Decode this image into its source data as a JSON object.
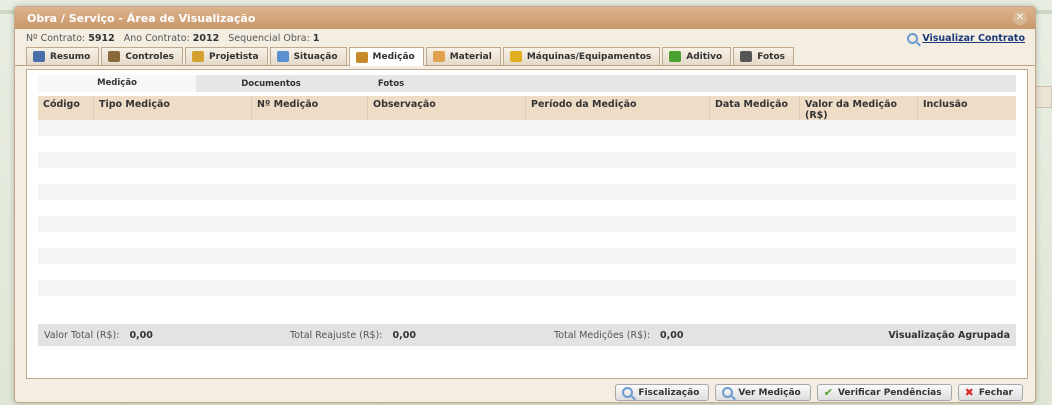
{
  "window": {
    "title": "Obra / Serviço - Área de Visualização",
    "close": "✕"
  },
  "info": {
    "contrato_label": "Nº Contrato:",
    "contrato_value": "5912",
    "ano_label": "Ano Contrato:",
    "ano_value": "2012",
    "seq_label": "Sequencial Obra:",
    "seq_value": "1",
    "view_contract": "Visualizar Contrato"
  },
  "tabs": [
    {
      "label": "Resumo",
      "icon": "document-icon",
      "color": "#4a6ea8"
    },
    {
      "label": "Controles",
      "icon": "user-icon",
      "color": "#8a6a3a"
    },
    {
      "label": "Projetista",
      "icon": "person-icon",
      "color": "#d4a030"
    },
    {
      "label": "Situação",
      "icon": "info-icon",
      "color": "#5a8fd0"
    },
    {
      "label": "Medição",
      "icon": "tools-icon",
      "color": "#c88a2a"
    },
    {
      "label": "Material",
      "icon": "box-icon",
      "color": "#e0a050"
    },
    {
      "label": "Máquinas/Equipamentos",
      "icon": "hammer-icon",
      "color": "#e0b020"
    },
    {
      "label": "Aditivo",
      "icon": "plus-icon",
      "color": "#4aa030"
    },
    {
      "label": "Fotos",
      "icon": "camera-icon",
      "color": "#555555"
    }
  ],
  "active_tab": "Medição",
  "subtabs": [
    "Medição",
    "Documentos",
    "Fotos"
  ],
  "table": {
    "columns": [
      "Código",
      "Tipo Medição",
      "Nº Medição",
      "Observação",
      "Período da Medição",
      "Data Medição",
      "Valor da Medição (R$)",
      "Inclusão"
    ],
    "rows": []
  },
  "footer": {
    "valor_total_label": "Valor Total (R$):",
    "valor_total": "0,00",
    "reajuste_label": "Total Reajuste (R$):",
    "reajuste": "0,00",
    "medicoes_label": "Total Medições (R$):",
    "medicoes": "0,00",
    "agrupada": "Visualização Agrupada"
  },
  "buttons": {
    "fiscalizacao": "Fiscalização",
    "ver_medicao": "Ver Medição",
    "verificar": "Verificar Pendências",
    "fechar": "Fechar"
  }
}
